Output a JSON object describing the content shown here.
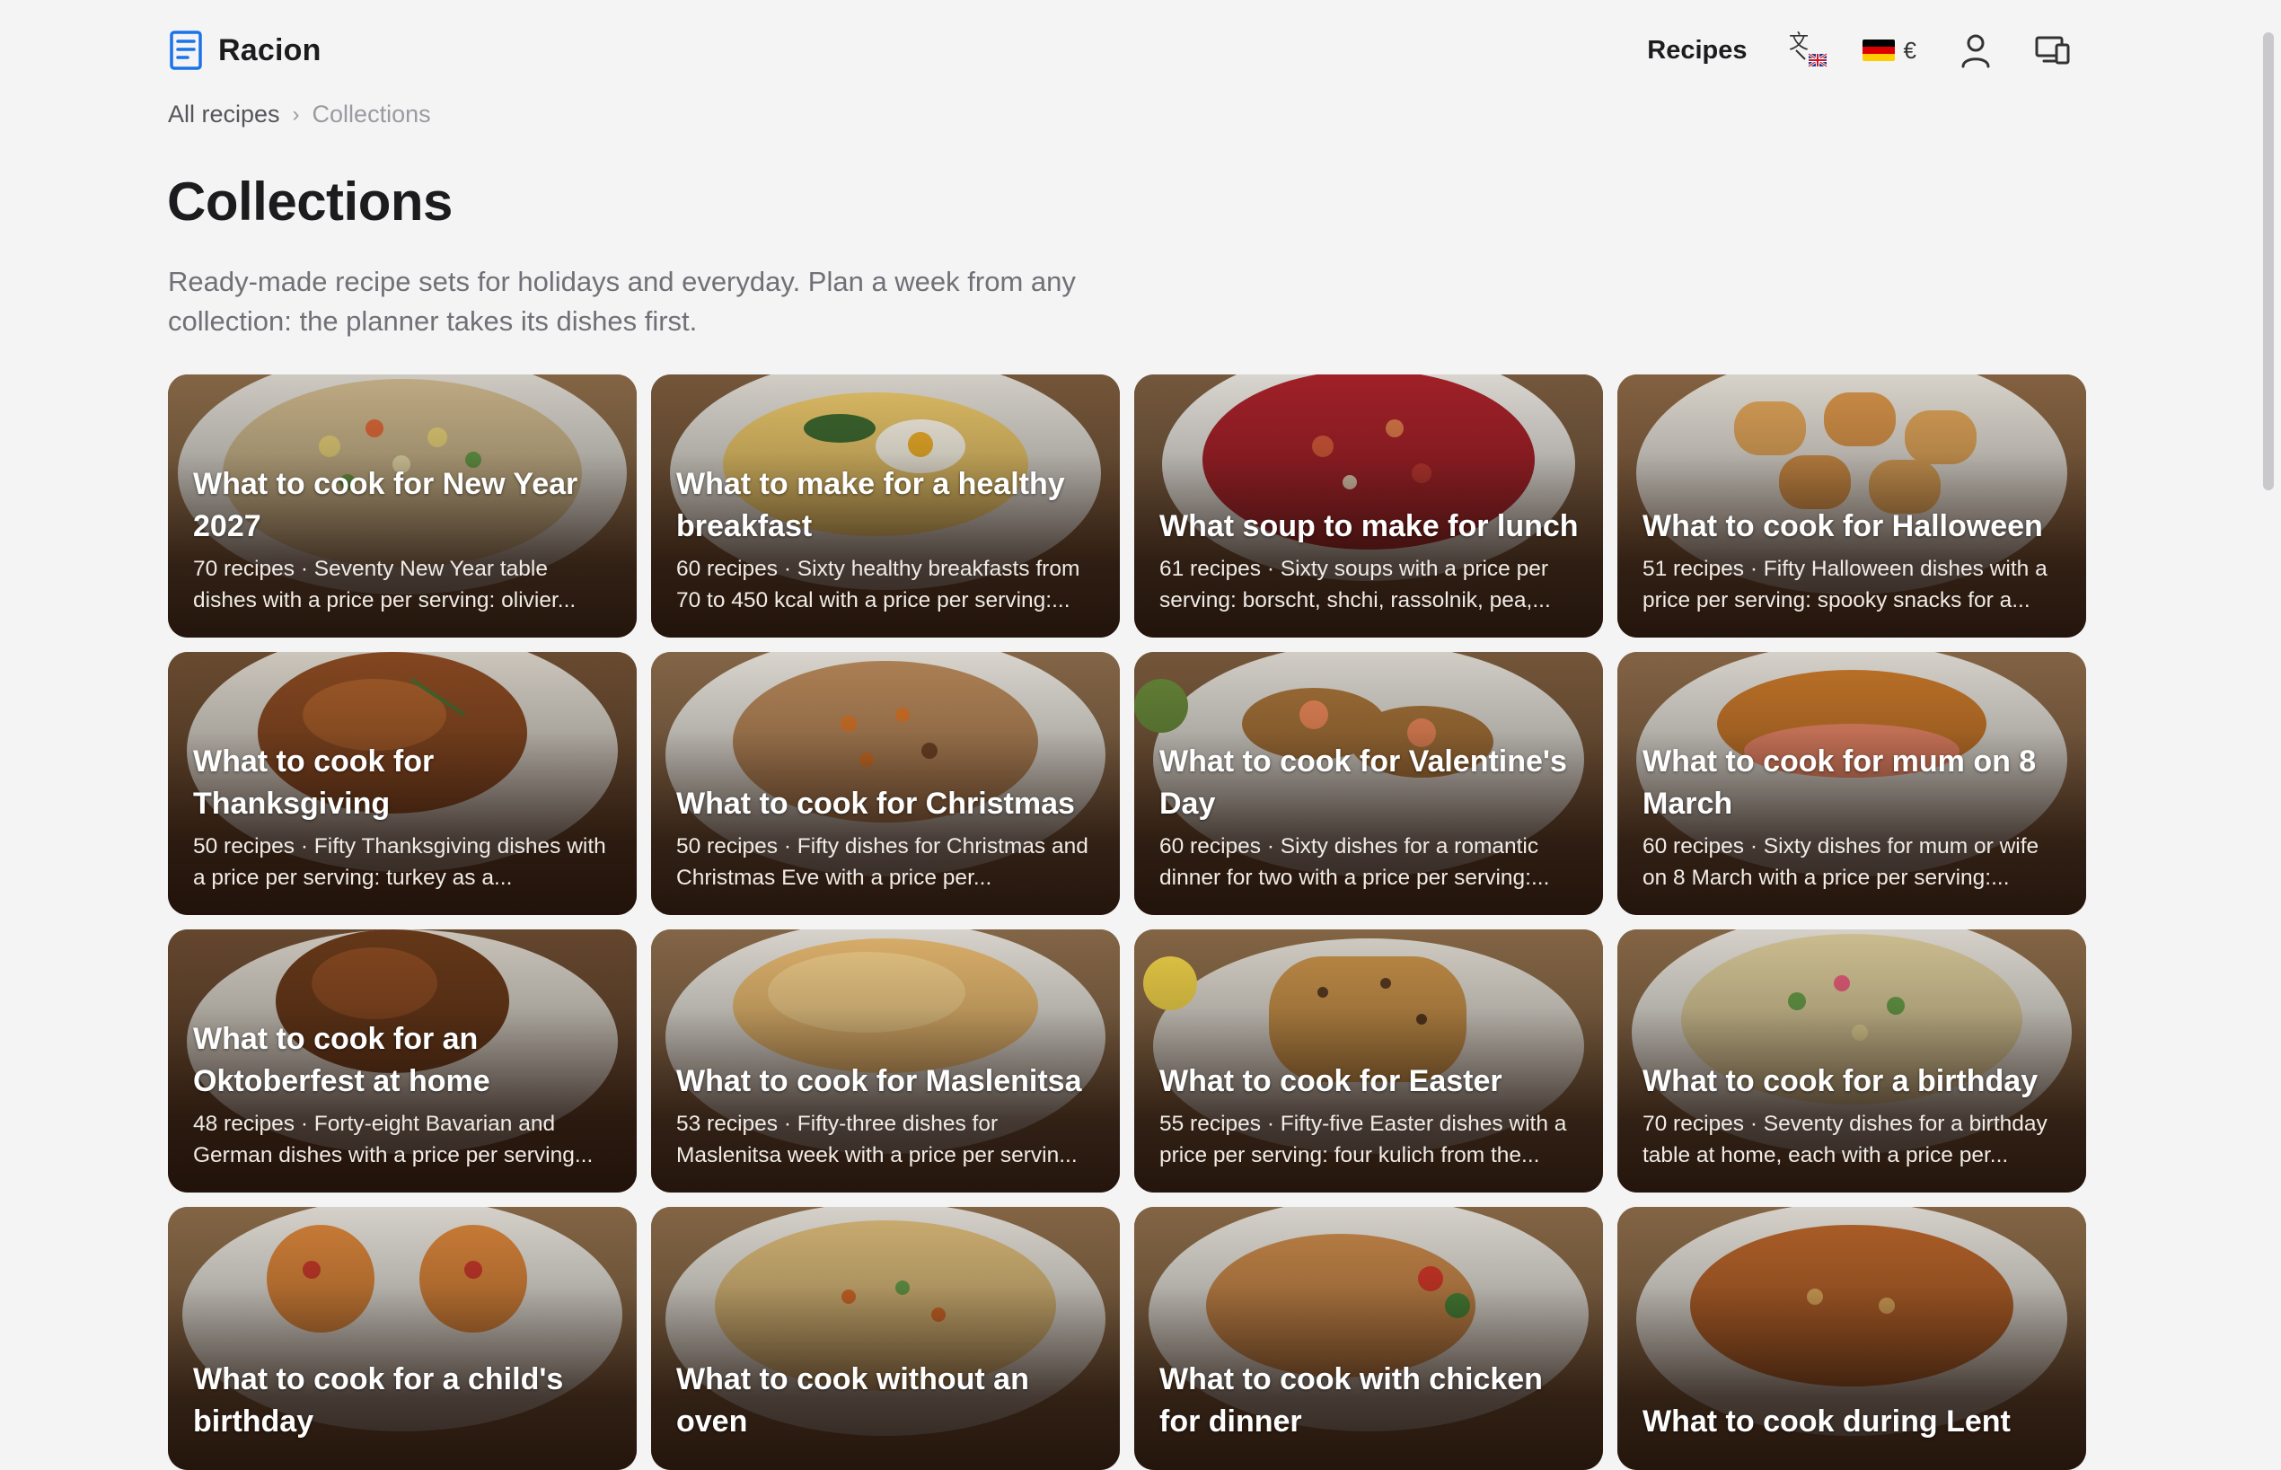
{
  "header": {
    "logo_text": "Racion",
    "nav_recipes": "Recipes",
    "currency_symbol": "€",
    "flag_colors": [
      "#000000",
      "#dd0000",
      "#ffce00"
    ],
    "icons": [
      "receipt-logo-icon",
      "translate-icon",
      "user-icon",
      "devices-icon"
    ]
  },
  "breadcrumb": {
    "home": "All recipes",
    "separator": "›",
    "current": "Collections"
  },
  "page": {
    "title": "Collections",
    "description": "Ready-made recipe sets for holidays and everyday. Plan a week from any collection: the planner takes its dishes first."
  },
  "colors": {
    "accent": "#1a73e8",
    "background": "#f4f4f5",
    "text": "#1c1c1e",
    "muted": "#707076"
  },
  "cards": [
    {
      "title": "What to cook for New Year 2027",
      "meta": "70 recipes · Seventy New Year table dishes with a price per serving: olivier...",
      "image": "olivier-salad-plate"
    },
    {
      "title": "What to make for a healthy breakfast",
      "meta": "60 recipes · Sixty healthy breakfasts from 70 to 450 kcal with a price per serving:...",
      "image": "omelette-plate"
    },
    {
      "title": "What soup to make for lunch",
      "meta": "61 recipes · Sixty soups with a price per serving: borscht, shchi, rassolnik, pea,...",
      "image": "borscht-bowl"
    },
    {
      "title": "What to cook for Halloween",
      "meta": "51 recipes · Fifty Halloween dishes with a price per serving: spooky snacks for a...",
      "image": "mummy-sausages"
    },
    {
      "title": "What to cook for Thanksgiving",
      "meta": "50 recipes · Fifty Thanksgiving dishes with a price per serving: turkey as a...",
      "image": "roast-turkey"
    },
    {
      "title": "What to cook for Christmas",
      "meta": "50 recipes · Fifty dishes for Christmas and Christmas Eve with a price per...",
      "image": "kutia-bowl"
    },
    {
      "title": "What to cook for Valentine's Day",
      "meta": "60 recipes · Sixty dishes for a romantic dinner for two with a price per serving:...",
      "image": "shrimp-toasts"
    },
    {
      "title": "What to cook for mum on 8 March",
      "meta": "60 recipes · Sixty dishes for mum or wife on 8 March with a price per serving:...",
      "image": "salmon-croissant"
    },
    {
      "title": "What to cook for an Oktoberfest at home",
      "meta": "48 recipes · Forty-eight Bavarian and German dishes with a price per serving...",
      "image": "pork-knuckle"
    },
    {
      "title": "What to cook for Maslenitsa",
      "meta": "53 recipes · Fifty-three dishes for Maslenitsa week with a price per servin...",
      "image": "blini-stack"
    },
    {
      "title": "What to cook for Easter",
      "meta": "55 recipes · Fifty-five Easter dishes with a price per serving: four kulich from the...",
      "image": "kulich-cake"
    },
    {
      "title": "What to cook for a birthday",
      "meta": "70 recipes · Seventy dishes for a birthday table at home, each with a price per...",
      "image": "festive-salad"
    },
    {
      "title": "What to cook for a child's birthday",
      "meta": "",
      "image": "mini-pizzas"
    },
    {
      "title": "What to cook without an oven",
      "meta": "",
      "image": "fried-rice"
    },
    {
      "title": "What to cook with chicken for dinner",
      "meta": "",
      "image": "chicken-salad"
    },
    {
      "title": "What to cook during Lent",
      "meta": "",
      "image": "lenten-stew"
    }
  ]
}
